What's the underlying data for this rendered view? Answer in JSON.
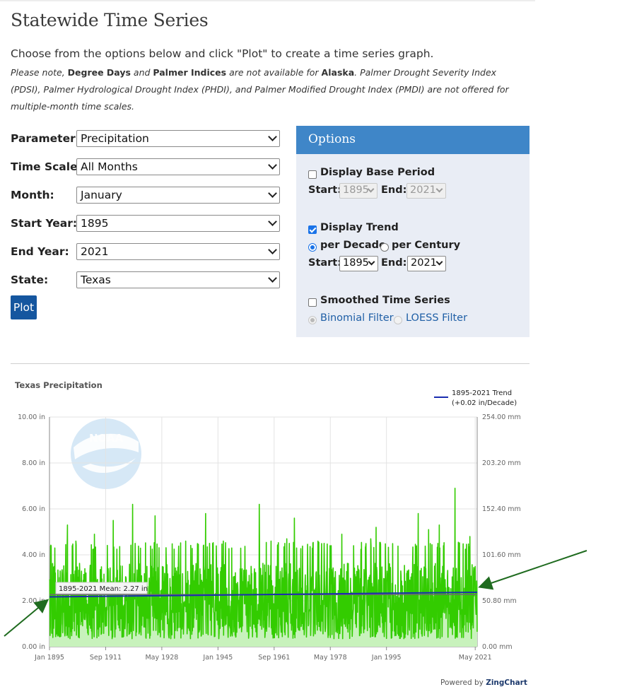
{
  "page": {
    "title": "Statewide Time Series",
    "intro": "Choose from the options below and click \"Plot\" to create a time series graph.",
    "note": {
      "t1": "Please note, ",
      "b1": "Degree Days",
      "t2": " and ",
      "b2": "Palmer Indices",
      "t3": " are not available for ",
      "b3": "Alaska",
      "t4": ". Palmer Drought Severity Index (PDSI), Palmer Hydrological Drought Index (PHDI), and Palmer Modified Drought Index (PMDI) are not offered for multiple-month time scales."
    }
  },
  "form": {
    "parameter": {
      "label": "Parameter:",
      "value": "Precipitation"
    },
    "time_scale": {
      "label": "Time Scale:",
      "value": "All Months"
    },
    "month": {
      "label": "Month:",
      "value": "January"
    },
    "start_year": {
      "label": "Start Year:",
      "value": "1895"
    },
    "end_year": {
      "label": "End Year:",
      "value": "2021"
    },
    "state": {
      "label": "State:",
      "value": "Texas"
    },
    "plot_label": "Plot"
  },
  "options": {
    "header": "Options",
    "base_period": {
      "label": "Display Base Period",
      "checked": false,
      "start_label": "Start:",
      "start": "1895",
      "end_label": "End:",
      "end": "2021"
    },
    "trend": {
      "label": "Display Trend",
      "checked": true,
      "per_decade": "per Decade",
      "per_century": "per Century",
      "start_label": "Start:",
      "start": "1895",
      "end_label": "End:",
      "end": "2021"
    },
    "smoothed": {
      "label": "Smoothed Time Series",
      "checked": false,
      "binomial": "Binomial Filter",
      "loess": "LOESS Filter"
    }
  },
  "colors": {
    "series": "#33cc00",
    "area": "#c8f2bc",
    "trend": "#1a2db0",
    "mean": "#6b6b6b",
    "arrow": "#1f6b1f"
  },
  "chart_data": {
    "type": "line",
    "title": "Texas Precipitation",
    "legend": {
      "position": "top-right",
      "line1": "1895-2021 Trend",
      "line2": "(+0.02 in/Decade)"
    },
    "y_left": {
      "ticks": [
        "0.00 in",
        "2.00 in",
        "4.00 in",
        "6.00 in",
        "8.00 in",
        "10.00 in"
      ],
      "range": [
        0,
        10
      ]
    },
    "y_right": {
      "ticks": [
        "0.00 mm",
        "50.80 mm",
        "101.60 mm",
        "152.40 mm",
        "203.20 mm",
        "254.00 mm"
      ]
    },
    "x_ticks": [
      "Jan 1895",
      "Sep 1911",
      "May 1928",
      "Jan 1945",
      "Sep 1961",
      "May 1978",
      "Jan 1995",
      "May 2021"
    ],
    "x_range": [
      "Jan 1895",
      "Dec 2021"
    ],
    "mean_label": "1895-2021 Mean: 2.27 in",
    "mean": 2.27,
    "trend": {
      "start": 2.17,
      "end": 2.37
    },
    "series": [
      {
        "note": "monthly precipitation, Jan 1895 - Dec 2021"
      }
    ],
    "peaks": [
      {
        "date": "1896-06",
        "value": 3.5
      },
      {
        "date": "1900-05",
        "value": 5.3
      },
      {
        "date": "1902-11",
        "value": 4.6
      },
      {
        "date": "1908-05",
        "value": 4.9
      },
      {
        "date": "1913-12",
        "value": 5.5
      },
      {
        "date": "1919-09",
        "value": 6.2
      },
      {
        "date": "1926-05",
        "value": 5.7
      },
      {
        "date": "1935-06",
        "value": 4.6
      },
      {
        "date": "1941-05",
        "value": 5.8
      },
      {
        "date": "1946-08",
        "value": 4.6
      },
      {
        "date": "1957-04",
        "value": 6.2
      },
      {
        "date": "1960-10",
        "value": 4.6
      },
      {
        "date": "1965-06",
        "value": 4.7
      },
      {
        "date": "1967-09",
        "value": 5.6
      },
      {
        "date": "1974-09",
        "value": 4.6
      },
      {
        "date": "1981-10",
        "value": 4.9
      },
      {
        "date": "1990-05",
        "value": 4.7
      },
      {
        "date": "1991-12",
        "value": 5.2
      },
      {
        "date": "2004-06",
        "value": 5.8
      },
      {
        "date": "2007-07",
        "value": 5.1
      },
      {
        "date": "2010-09",
        "value": 5.3
      },
      {
        "date": "2015-05",
        "value": 6.9
      },
      {
        "date": "2019-10",
        "value": 4.8
      }
    ]
  },
  "footer": {
    "powered_by": "Powered by",
    "brand": "ZingChart"
  }
}
